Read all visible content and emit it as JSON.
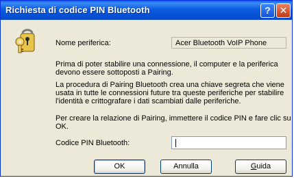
{
  "window": {
    "title": "Richiesta di codice PIN Bluetooth"
  },
  "titlebar": {
    "help_glyph": "?",
    "close_glyph": "✕"
  },
  "icon": {
    "name": "keys-icon"
  },
  "device": {
    "label": "Nome periferica:",
    "value": "Acer Bluetooth VoIP Phone"
  },
  "body": {
    "paragraph1_line1": "Prima di poter stabilire una connessione, il computer e la periferica",
    "paragraph1_line2": "devono essere sottoposti a Pairing.",
    "paragraph2_line1": "La procedura di Pairing Bluetooth crea una chiave segreta che viene",
    "paragraph2_line2": "usata in tutte le connessioni future tra queste periferiche per stabilire",
    "paragraph2_line3": "l'identità e crittografare i dati scambiati dalle periferiche.",
    "paragraph3_line1": "Per creare la relazione di Pairing, immettere il codice PIN e fare clic su",
    "paragraph3_line2": "OK."
  },
  "pin": {
    "label": "Codice PIN Bluetooth:",
    "value": ""
  },
  "buttons": {
    "ok": "OK",
    "cancel": "Annulla",
    "help_accel": "G",
    "help_rest": "uida"
  }
}
